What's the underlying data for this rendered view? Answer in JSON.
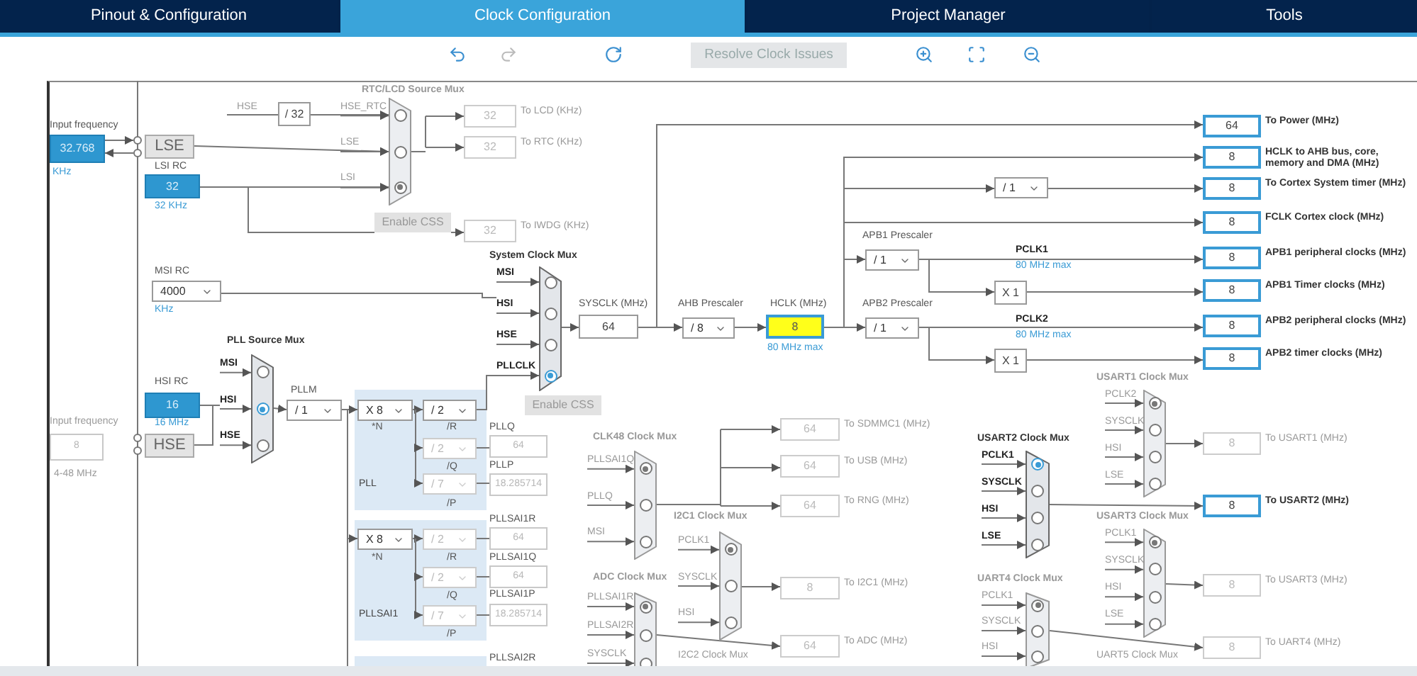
{
  "tabs": [
    {
      "label": "Pinout & Configuration",
      "selected": false
    },
    {
      "label": "Clock Configuration",
      "selected": true
    },
    {
      "label": "Project Manager",
      "selected": false
    },
    {
      "label": "Tools",
      "selected": false
    }
  ],
  "toolbar": {
    "resolve_button": "Resolve Clock Issues"
  },
  "labels": [
    {
      "text": "Input frequency",
      "kind": "caption"
    },
    {
      "text": "KHz",
      "kind": "note"
    },
    {
      "text": "LSI RC",
      "kind": "caption"
    },
    {
      "text": "32 KHz",
      "kind": "note"
    },
    {
      "text": "MSI RC",
      "kind": "caption"
    },
    {
      "text": "KHz",
      "kind": "note"
    },
    {
      "text": "HSI RC",
      "kind": "caption"
    },
    {
      "text": "Input frequency",
      "kind": "dim"
    },
    {
      "text": "16 MHz",
      "kind": "note"
    },
    {
      "text": "4-48 MHz",
      "kind": "dim"
    },
    {
      "text": "HSE",
      "kind": "dim"
    },
    {
      "text": "PLLM",
      "kind": "caption"
    },
    {
      "text": "*N",
      "kind": "caption"
    },
    {
      "text": "/R",
      "kind": "caption"
    },
    {
      "text": "/Q",
      "kind": "caption"
    },
    {
      "text": "/P",
      "kind": "caption"
    },
    {
      "text": "PLLQ",
      "kind": "caption"
    },
    {
      "text": "PLLP",
      "kind": "caption"
    },
    {
      "text": "*N",
      "kind": "caption"
    },
    {
      "text": "/R",
      "kind": "caption"
    },
    {
      "text": "/Q",
      "kind": "caption"
    },
    {
      "text": "/P",
      "kind": "caption"
    },
    {
      "text": "PLLSAI1R",
      "kind": "caption"
    },
    {
      "text": "PLLSAI1Q",
      "kind": "caption"
    },
    {
      "text": "PLLSAI1P",
      "kind": "caption"
    },
    {
      "text": "PLLSAI2R",
      "kind": "caption"
    },
    {
      "text": "SYSCLK (MHz)",
      "kind": "caption"
    },
    {
      "text": "AHB Prescaler",
      "kind": "caption"
    },
    {
      "text": "HCLK (MHz)",
      "kind": "caption"
    },
    {
      "text": "80 MHz max",
      "kind": "note"
    },
    {
      "text": "APB1 Prescaler",
      "kind": "caption"
    },
    {
      "text": "APB2 Prescaler",
      "kind": "caption"
    },
    {
      "text": "PCLK1",
      "kind": "bold"
    },
    {
      "text": "80 MHz max",
      "kind": "note"
    },
    {
      "text": "PCLK2",
      "kind": "bold"
    },
    {
      "text": "80 MHz max",
      "kind": "note"
    },
    {
      "text": "I2C2 Clock Mux",
      "kind": "dim"
    },
    {
      "text": "UART5 Clock Mux",
      "kind": "dim"
    }
  ],
  "value_boxes": [
    {
      "value": "32.768",
      "kind": "input"
    },
    {
      "value": "32",
      "kind": "input"
    },
    {
      "value": "16",
      "kind": "input"
    },
    {
      "value": "8",
      "kind": "disabled"
    },
    {
      "value": "/ 32",
      "kind": "plain"
    },
    {
      "value": "64",
      "kind": "plain"
    },
    {
      "value": "8",
      "kind": "highlight"
    },
    {
      "value": "X 1",
      "kind": "plain"
    },
    {
      "value": "X 1",
      "kind": "plain"
    },
    {
      "value": "64",
      "kind": "disabled"
    },
    {
      "value": "18.285714",
      "kind": "disabled"
    },
    {
      "value": "64",
      "kind": "disabled"
    },
    {
      "value": "64",
      "kind": "disabled"
    },
    {
      "value": "18.285714",
      "kind": "disabled"
    }
  ],
  "dropdowns": [
    {
      "value": "4000",
      "disabled": false
    },
    {
      "value": "/ 1",
      "disabled": false
    },
    {
      "value": "X 8",
      "disabled": false
    },
    {
      "value": "/ 2",
      "disabled": false
    },
    {
      "value": "/ 2",
      "disabled": true
    },
    {
      "value": "/ 7",
      "disabled": true
    },
    {
      "value": "X 8",
      "disabled": false
    },
    {
      "value": "/ 2",
      "disabled": true
    },
    {
      "value": "/ 2",
      "disabled": true
    },
    {
      "value": "/ 7",
      "disabled": true
    },
    {
      "value": "/ 8",
      "disabled": false
    },
    {
      "value": "/ 1",
      "disabled": false
    },
    {
      "value": "/ 1",
      "disabled": false
    },
    {
      "value": "/ 1",
      "disabled": false
    }
  ],
  "buttons": [
    {
      "label": "LSE",
      "kind": "source"
    },
    {
      "label": "HSE",
      "kind": "source"
    },
    {
      "label": "Enable CSS",
      "kind": "css"
    },
    {
      "label": "Enable CSS",
      "kind": "css"
    }
  ],
  "pll_panels": [
    {
      "name": "PLL"
    },
    {
      "name": "PLLSAI1"
    }
  ],
  "muxes": [
    {
      "title": "RTC/LCD Source Mux",
      "active": false,
      "inputs": [
        {
          "label": "HSE_RTC",
          "selected": false
        },
        {
          "label": "LSE",
          "selected": false
        },
        {
          "label": "LSI",
          "selected": true
        }
      ]
    },
    {
      "title": "System Clock Mux",
      "active": true,
      "inputs": [
        {
          "label": "MSI",
          "selected": false
        },
        {
          "label": "HSI",
          "selected": false
        },
        {
          "label": "HSE",
          "selected": false
        },
        {
          "label": "PLLCLK",
          "selected": true
        }
      ]
    },
    {
      "title": "PLL Source Mux",
      "active": true,
      "inputs": [
        {
          "label": "MSI",
          "selected": false
        },
        {
          "label": "HSI",
          "selected": true
        },
        {
          "label": "HSE",
          "selected": false
        }
      ]
    },
    {
      "title": "CLK48 Clock Mux",
      "active": false,
      "inputs": [
        {
          "label": "PLLSAI1Q",
          "selected": true
        },
        {
          "label": "PLLQ",
          "selected": false
        },
        {
          "label": "MSI",
          "selected": false
        }
      ]
    },
    {
      "title": "I2C1 Clock Mux",
      "active": false,
      "inputs": [
        {
          "label": "PCLK1",
          "selected": true
        },
        {
          "label": "SYSCLK",
          "selected": false
        },
        {
          "label": "HSI",
          "selected": false
        }
      ]
    },
    {
      "title": "ADC Clock Mux",
      "active": false,
      "inputs": [
        {
          "label": "PLLSAI1R",
          "selected": true
        },
        {
          "label": "PLLSAI2R",
          "selected": false
        },
        {
          "label": "SYSCLK",
          "selected": false
        }
      ]
    },
    {
      "title": "USART1 Clock Mux",
      "active": false,
      "inputs": [
        {
          "label": "PCLK2",
          "selected": true
        },
        {
          "label": "SYSCLK",
          "selected": false
        },
        {
          "label": "HSI",
          "selected": false
        },
        {
          "label": "LSE",
          "selected": false
        }
      ]
    },
    {
      "title": "USART2 Clock Mux",
      "active": true,
      "inputs": [
        {
          "label": "PCLK1",
          "selected": true
        },
        {
          "label": "SYSCLK",
          "selected": false
        },
        {
          "label": "HSI",
          "selected": false
        },
        {
          "label": "LSE",
          "selected": false
        }
      ]
    },
    {
      "title": "USART3 Clock Mux",
      "active": false,
      "inputs": [
        {
          "label": "PCLK1",
          "selected": true
        },
        {
          "label": "SYSCLK",
          "selected": false
        },
        {
          "label": "HSI",
          "selected": false
        },
        {
          "label": "LSE",
          "selected": false
        }
      ]
    },
    {
      "title": "UART4 Clock Mux",
      "active": false,
      "inputs": [
        {
          "label": "PCLK1",
          "selected": true
        },
        {
          "label": "SYSCLK",
          "selected": false
        },
        {
          "label": "HSI",
          "selected": false
        }
      ]
    }
  ],
  "rtc_outputs": [
    {
      "value": "32",
      "label": "To LCD (KHz)",
      "active": false
    },
    {
      "value": "32",
      "label": "To RTC (KHz)",
      "active": false
    },
    {
      "value": "32",
      "label": "To IWDG (KHz)",
      "active": false
    }
  ],
  "peripheral_outputs": [
    {
      "value": "64",
      "label": "To SDMMC1 (MHz)",
      "active": false
    },
    {
      "value": "64",
      "label": "To USB (MHz)",
      "active": false
    },
    {
      "value": "64",
      "label": "To RNG (MHz)",
      "active": false
    },
    {
      "value": "8",
      "label": "To I2C1 (MHz)",
      "active": false
    },
    {
      "value": "64",
      "label": "To ADC (MHz)",
      "active": false
    }
  ],
  "outputs": [
    {
      "value": "64",
      "label": "To Power (MHz)",
      "active": true
    },
    {
      "value": "8",
      "label": "HCLK to AHB bus, core, memory and DMA (MHz)",
      "active": true
    },
    {
      "value": "8",
      "label": "To Cortex System timer (MHz)",
      "active": true
    },
    {
      "value": "8",
      "label": "FCLK Cortex clock (MHz)",
      "active": true
    },
    {
      "value": "8",
      "label": "APB1 peripheral clocks (MHz)",
      "active": true
    },
    {
      "value": "8",
      "label": "APB1 Timer clocks (MHz)",
      "active": true
    },
    {
      "value": "8",
      "label": "APB2 peripheral clocks (MHz)",
      "active": true
    },
    {
      "value": "8",
      "label": "APB2 timer clocks (MHz)",
      "active": true
    },
    {
      "value": "8",
      "label": "To USART1 (MHz)",
      "active": false
    },
    {
      "value": "8",
      "label": "To USART2 (MHz)",
      "active": true
    },
    {
      "value": "8",
      "label": "To USART3 (MHz)",
      "active": false
    },
    {
      "value": "8",
      "label": "To UART4 (MHz)",
      "active": false
    }
  ]
}
